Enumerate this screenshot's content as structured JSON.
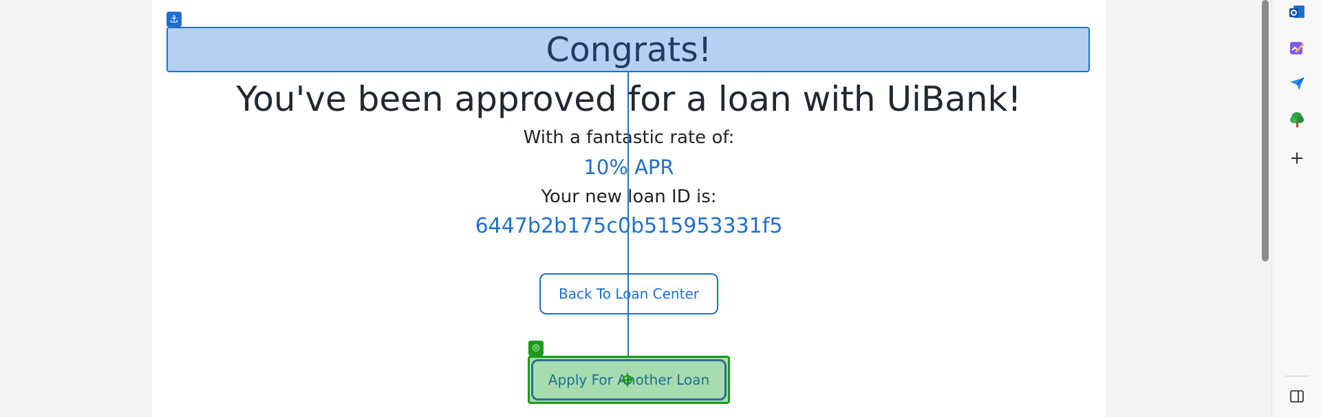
{
  "main": {
    "congrats": "Congrats!",
    "headline": "You've been approved for a loan with UiBank!",
    "rate_label": "With a fantastic rate of:",
    "rate_value": "10% APR",
    "id_label": "Your new loan ID is:",
    "id_value": "6447b2b175c0b515953331f5",
    "back_button": "Back To Loan Center",
    "apply_button": "Apply For Another Loan"
  },
  "overlay": {
    "anchor_icon": "⚓",
    "target_icon": "◎"
  },
  "side_panel": {
    "icons": [
      "outlook-icon",
      "designer-icon",
      "send-icon",
      "tree-icon",
      "plus-icon",
      "sidebar-toggle-icon"
    ],
    "plus_glyph": "+"
  },
  "colors": {
    "accent": "#1e6fd0",
    "highlight_blue": "#b3d1f3",
    "highlight_green": "#a7dbb0",
    "target_green": "#1a9a1a"
  }
}
